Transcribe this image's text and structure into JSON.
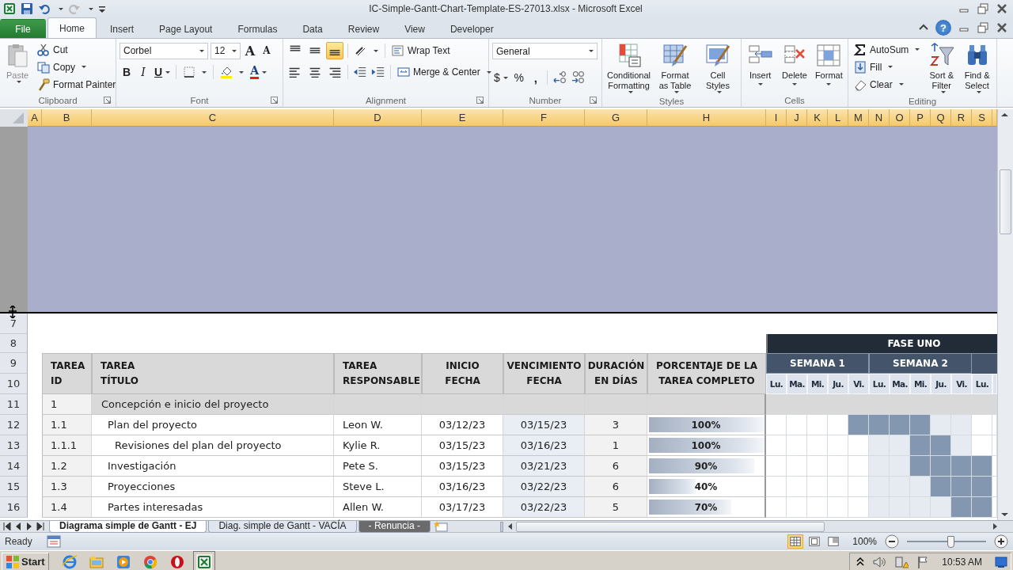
{
  "window": {
    "title": "IC-Simple-Gantt-Chart-Template-ES-27013.xlsx -  Microsoft Excel"
  },
  "ribbon_tabs": [
    {
      "label": "File",
      "kind": "menu",
      "selected": false
    },
    {
      "label": "Home",
      "kind": "tab",
      "selected": true
    },
    {
      "label": "Insert",
      "kind": "tab",
      "selected": false
    },
    {
      "label": "Page Layout",
      "kind": "tab",
      "selected": false
    },
    {
      "label": "Formulas",
      "kind": "tab",
      "selected": false
    },
    {
      "label": "Data",
      "kind": "tab",
      "selected": false
    },
    {
      "label": "Review",
      "kind": "tab",
      "selected": false
    },
    {
      "label": "View",
      "kind": "tab",
      "selected": false
    },
    {
      "label": "Developer",
      "kind": "tab",
      "selected": false
    }
  ],
  "help": "?",
  "ribbon": {
    "clipboard": {
      "label": "Clipboard",
      "paste": "Paste",
      "cut": "Cut",
      "copy": "Copy",
      "format_painter": "Format Painter"
    },
    "font": {
      "label": "Font",
      "font_name": "Corbel",
      "font_size": "12",
      "grow": "A",
      "shrink": "A",
      "bold": "B",
      "italic": "I",
      "underline": "U",
      "font_color": "A"
    },
    "alignment": {
      "label": "Alignment",
      "vertical_align": [
        {
          "selected": false
        },
        {
          "selected": false
        },
        {
          "selected": true
        }
      ],
      "wrap_text": "Wrap Text",
      "merge_center": "Merge & Center"
    },
    "number": {
      "label": "Number",
      "format": "General",
      "currency": "$",
      "percent": "%",
      "comma": ","
    },
    "styles": {
      "label": "Styles",
      "buttons": [
        "Conditional Formatting",
        "Format as Table",
        "Cell Styles"
      ]
    },
    "cells": {
      "label": "Cells",
      "buttons": [
        "Insert",
        "Delete",
        "Format"
      ]
    },
    "editing": {
      "label": "Editing",
      "autosum": "AutoSum",
      "fill": "Fill",
      "clear": "Clear",
      "buttons": [
        "Sort & Filter",
        "Find & Select"
      ]
    }
  },
  "sheet": {
    "columns": [
      {
        "label": "A",
        "selected": true
      },
      {
        "label": "B",
        "selected": true
      },
      {
        "label": "C",
        "selected": true
      },
      {
        "label": "D",
        "selected": true
      },
      {
        "label": "E",
        "selected": true
      },
      {
        "label": "F",
        "selected": true
      },
      {
        "label": "G",
        "selected": true
      },
      {
        "label": "H",
        "selected": true
      },
      {
        "label": "I",
        "selected": true
      },
      {
        "label": "J",
        "selected": true
      },
      {
        "label": "K",
        "selected": true
      },
      {
        "label": "L",
        "selected": true
      },
      {
        "label": "M",
        "selected": true
      },
      {
        "label": "N",
        "selected": true
      },
      {
        "label": "O",
        "selected": true
      },
      {
        "label": "P",
        "selected": true
      },
      {
        "label": "Q",
        "selected": true
      },
      {
        "label": "R",
        "selected": true
      },
      {
        "label": "S",
        "selected": true
      }
    ],
    "row_numbers": [
      "7",
      "8",
      "9",
      "10",
      "11",
      "12",
      "13",
      "14",
      "15",
      "16"
    ],
    "table": {
      "headers": [
        [
          "TAREA",
          "ID"
        ],
        [
          "TAREA",
          "TÍTULO"
        ],
        [
          "TAREA",
          "RESPONSABLE"
        ],
        [
          "INICIO",
          "FECHA"
        ],
        [
          "VENCIMIENTO",
          "FECHA"
        ],
        [
          "DURACIÓN",
          "EN DÍAS"
        ],
        [
          "PORCENTAJE DE LA",
          "TAREA COMPLETO"
        ]
      ],
      "tasks": [
        {
          "id": "1",
          "title": "Concepción e inicio del proyecto",
          "children": [
            {
              "id": "1.1",
              "title": "Plan del proyecto",
              "owner": "Leon W.",
              "start": "03/12/23",
              "due": "03/15/23",
              "duration": "3",
              "percent": "100%",
              "level": 1,
              "bars": [
                false,
                false,
                false,
                false,
                true,
                true,
                true,
                true,
                false,
                false,
                false
              ],
              "children": [
                {
                  "id": "1.1.1",
                  "title": "Revisiones del plan del proyecto",
                  "owner": "Kylie R.",
                  "start": "03/15/23",
                  "due": "03/16/23",
                  "duration": "1",
                  "percent": "100%",
                  "level": 1,
                  "bars": [
                    false,
                    false,
                    false,
                    false,
                    false,
                    false,
                    false,
                    true,
                    true,
                    false,
                    false
                  ]
                }
              ]
            },
            {
              "id": "1.2",
              "title": "Investigación",
              "owner": "Pete S.",
              "start": "03/15/23",
              "due": "03/21/23",
              "duration": "6",
              "percent": "90%",
              "level": 0.9,
              "bars": [
                false,
                false,
                false,
                false,
                false,
                false,
                false,
                true,
                true,
                true,
                true
              ]
            },
            {
              "id": "1.3",
              "title": "Proyecciones",
              "owner": "Steve L.",
              "start": "03/16/23",
              "due": "03/22/23",
              "duration": "6",
              "percent": "40%",
              "level": 0.4,
              "bars": [
                false,
                false,
                false,
                false,
                false,
                false,
                false,
                false,
                true,
                true,
                true
              ]
            },
            {
              "id": "1.4",
              "title": "Partes interesadas",
              "owner": "Allen W.",
              "start": "03/17/23",
              "due": "03/22/23",
              "duration": "5",
              "percent": "70%",
              "level": 0.7,
              "bars": [
                false,
                false,
                false,
                false,
                false,
                false,
                false,
                false,
                false,
                true,
                true
              ]
            }
          ]
        }
      ]
    },
    "gantt": {
      "phase": "FASE UNO",
      "weeks": [
        "SEMANA 1",
        "SEMANA 2"
      ],
      "days": [
        {
          "label": "Lu.",
          "highlighted": false
        },
        {
          "label": "Ma.",
          "highlighted": false
        },
        {
          "label": "Mi.",
          "highlighted": false
        },
        {
          "label": "Ju.",
          "highlighted": false
        },
        {
          "label": "Vi.",
          "highlighted": false
        },
        {
          "label": "Lu.",
          "highlighted": true
        },
        {
          "label": "Ma.",
          "highlighted": true
        },
        {
          "label": "Mi.",
          "highlighted": true
        },
        {
          "label": "Ju.",
          "highlighted": true
        },
        {
          "label": "Vi.",
          "highlighted": true
        },
        {
          "label": "Lu.",
          "highlighted": false
        }
      ]
    }
  },
  "sheet_tabs": [
    {
      "label": "Diagrama simple de Gantt - EJ",
      "selected": true,
      "color": "#ffffff"
    },
    {
      "label": "Diag. simple de Gantt - VACÍA",
      "selected": false,
      "color": "#dfe6ef"
    },
    {
      "label": "- Renuncia -",
      "selected": false,
      "color": "#6b6b6b"
    }
  ],
  "status_bar": {
    "status": "Ready",
    "views": [
      {
        "selected": true
      },
      {
        "selected": false
      },
      {
        "selected": false
      }
    ],
    "zoom": "100%",
    "level": 0.55
  },
  "taskbar": {
    "start": "Start",
    "apps": [
      {
        "kind": "globe",
        "selected": false
      },
      {
        "kind": "folder",
        "selected": false
      },
      {
        "kind": "player",
        "selected": false
      },
      {
        "kind": "wheel",
        "selected": false
      },
      {
        "kind": "ring",
        "selected": false
      },
      {
        "kind": "sheet",
        "selected": true
      }
    ],
    "clock": "10:53 AM"
  }
}
